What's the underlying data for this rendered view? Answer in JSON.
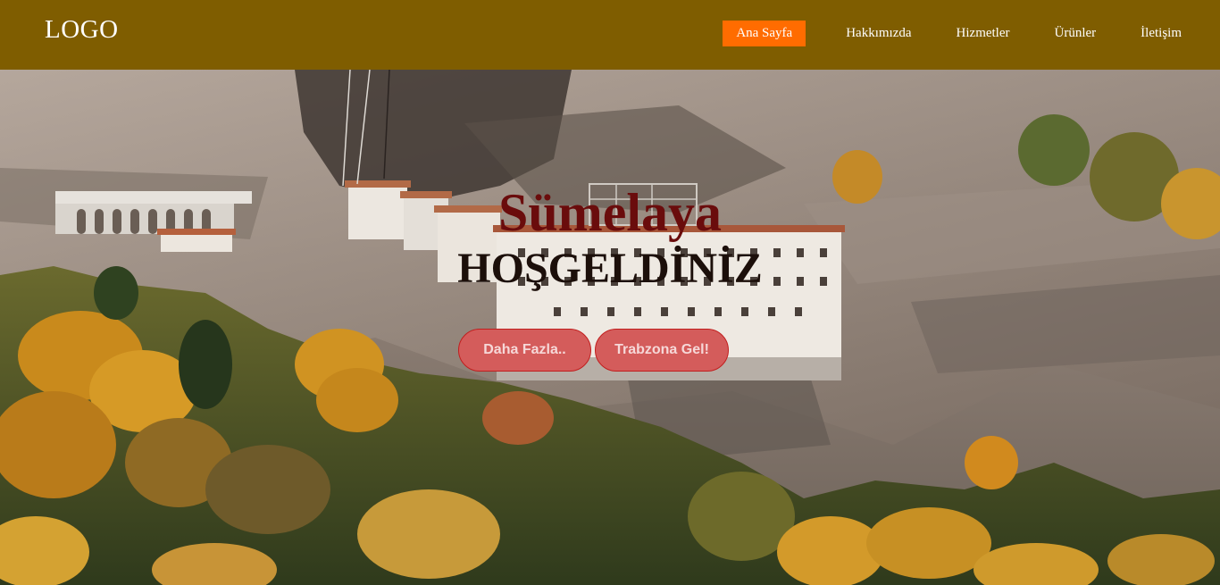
{
  "header": {
    "logo": "LOGO",
    "nav": [
      {
        "label": "Ana Sayfa",
        "active": true
      },
      {
        "label": "Hakkımızda",
        "active": false
      },
      {
        "label": "Hizmetler",
        "active": false
      },
      {
        "label": "Ürünler",
        "active": false
      },
      {
        "label": "İletişim",
        "active": false
      }
    ]
  },
  "hero": {
    "title_line1": "Sümelaya",
    "title_line2": "HOŞGELDİNİZ",
    "buttons": {
      "more": "Daha Fazla..",
      "visit": "Trabzona Gel!"
    },
    "background": "sumela-monastery-cliff-photo"
  },
  "colors": {
    "header_bg": "#7f5d00",
    "nav_active_bg": "#ff6c00",
    "title_line1": "#6a0c0c",
    "title_line2": "#1c0f0a",
    "button_bg": "#d45c5b",
    "button_border": "#c11e1e",
    "button_text": "#f6d8d8"
  }
}
